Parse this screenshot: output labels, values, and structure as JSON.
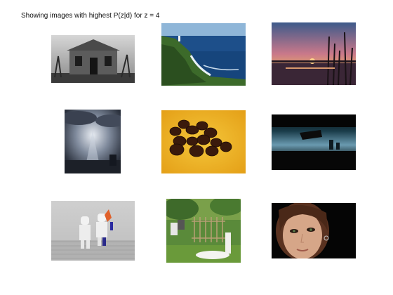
{
  "figure": {
    "title": "Showing images with highest P(z|d) for z = 4"
  },
  "images": [
    {
      "name": "abandoned-house-photo"
    },
    {
      "name": "coastal-cliff-ocean-photo"
    },
    {
      "name": "sunset-over-water-reeds-photo"
    },
    {
      "name": "dramatic-clouds-sunrays-photo"
    },
    {
      "name": "coffee-beans-closeup-photo"
    },
    {
      "name": "dusk-skyline-silhouette-photo"
    },
    {
      "name": "toy-stormtroopers-photo"
    },
    {
      "name": "garden-statue-fence-photo"
    },
    {
      "name": "woman-portrait-photo"
    }
  ]
}
